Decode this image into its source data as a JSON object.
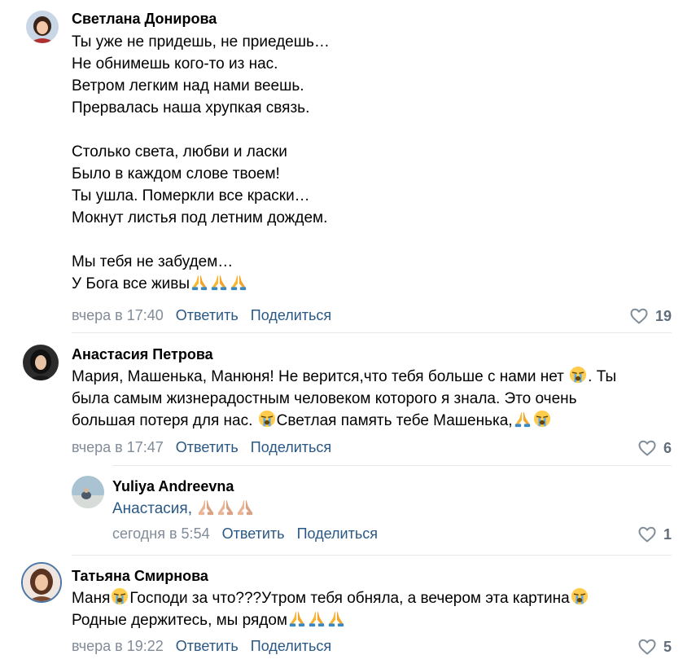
{
  "comments": [
    {
      "author": "Светлана Донирова",
      "lines": [
        "Ты уже не придешь, не приедешь…",
        "Не обнимешь кого-то из нас.",
        "Ветром легким над нами веешь.",
        "Прервалась наша хрупкая связь.",
        "",
        "Столько света, любви и ласки",
        "Было в каждом слове твоем!",
        "Ты ушла. Померкли все краски…",
        "Мокнут листья под летним дождем.",
        "",
        "Мы тебя не забудем…",
        "У Бога все живы"
      ],
      "time": "вчера в 17:40",
      "reply_label": "Ответить",
      "share_label": "Поделиться",
      "likes": "19"
    },
    {
      "author": "Анастасия Петрова",
      "line1": "Мария, Машенька, Манюня! Не верится,что тебя больше с нами нет",
      "line1_tail": ". Ты",
      "line2": "была самым жизнерадостным человеком которого я знала. Это очень",
      "line3a": "большая потеря для нас.",
      "line3b": "Светлая память тебе Машенька,",
      "time": "вчера в 17:47",
      "reply_label": "Ответить",
      "share_label": "Поделиться",
      "likes": "6"
    },
    {
      "author": "Yuliya Andreevna",
      "mention": "Анастасия",
      "mention_sep": ",",
      "time": "сегодня в 5:54",
      "reply_label": "Ответить",
      "share_label": "Поделиться",
      "likes": "1"
    },
    {
      "author": "Татьяна Смирнова",
      "line1a": "Маня",
      "line1b": "Господи за что???Утром тебя обняла, а вечером эта картина",
      "line2": "Родные держитесь, мы рядом",
      "time": "вчера в 19:22",
      "reply_label": "Ответить",
      "share_label": "Поделиться",
      "likes": "5"
    }
  ],
  "icons": {
    "like": "heart-outline-icon",
    "pray": "folded-hands-emoji",
    "cry": "loudly-crying-face-emoji"
  },
  "colors": {
    "link": "#2a5885",
    "meta": "#818c99",
    "likes": "#626d7a",
    "divider": "#e7e8ec"
  }
}
